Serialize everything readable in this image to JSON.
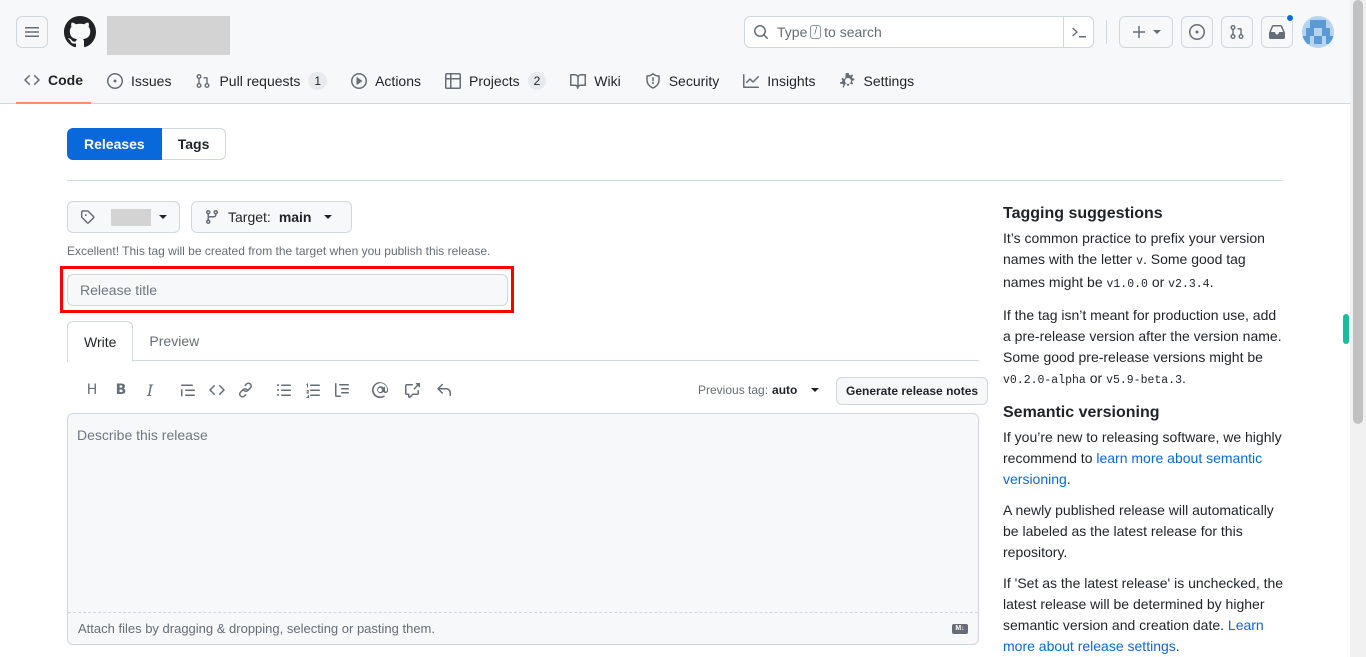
{
  "header": {
    "search_placeholder_pre": "Type",
    "search_slash": "/",
    "search_placeholder_post": "to search"
  },
  "nav": {
    "tabs": [
      {
        "label": "Code",
        "icon": "code-icon"
      },
      {
        "label": "Issues",
        "icon": "issue-icon"
      },
      {
        "label": "Pull requests",
        "icon": "pull-request-icon",
        "count": "1"
      },
      {
        "label": "Actions",
        "icon": "play-icon"
      },
      {
        "label": "Projects",
        "icon": "table-icon",
        "count": "2"
      },
      {
        "label": "Wiki",
        "icon": "book-icon"
      },
      {
        "label": "Security",
        "icon": "shield-icon"
      },
      {
        "label": "Insights",
        "icon": "graph-icon"
      },
      {
        "label": "Settings",
        "icon": "gear-icon"
      }
    ]
  },
  "releases": {
    "seg_releases": "Releases",
    "seg_tags": "Tags",
    "target_label": "Target:",
    "target_value": "main",
    "hint": "Excellent! This tag will be created from the target when you publish this release.",
    "title_placeholder": "Release title",
    "tab_write": "Write",
    "tab_preview": "Preview",
    "prev_tag_label": "Previous tag:",
    "prev_tag_value": "auto",
    "generate_label": "Generate release notes",
    "body_placeholder": "Describe this release",
    "attach_hint": "Attach files by dragging & dropping, selecting or pasting them."
  },
  "sidebar": {
    "tagging_title": "Tagging suggestions",
    "tagging_p1_a": "It’s common practice to prefix your version names with the letter",
    "tagging_p1_v": "v",
    "tagging_p1_b": ". Some good tag names might be",
    "tagging_p1_c1": "v1.0.0",
    "tagging_p1_or": "or",
    "tagging_p1_c2": "v2.3.4",
    "tagging_p2_a": "If the tag isn’t meant for production use, add a pre-release version after the version name. Some good pre-release versions might be",
    "tagging_p2_c1": "v0.2.0-alpha",
    "tagging_p2_or": "or",
    "tagging_p2_c2": "v5.9-beta.3",
    "semver_title": "Semantic versioning",
    "semver_p1_a": "If you’re new to releasing software, we highly recommend to",
    "semver_p1_link": "learn more about semantic versioning",
    "semver_p2": "A newly published release will automatically be labeled as the latest release for this repository.",
    "semver_p3_a": "If 'Set as the latest release' is unchecked, the latest release will be determined by higher semantic version and creation date.",
    "semver_p3_link": "Learn more about release settings"
  }
}
